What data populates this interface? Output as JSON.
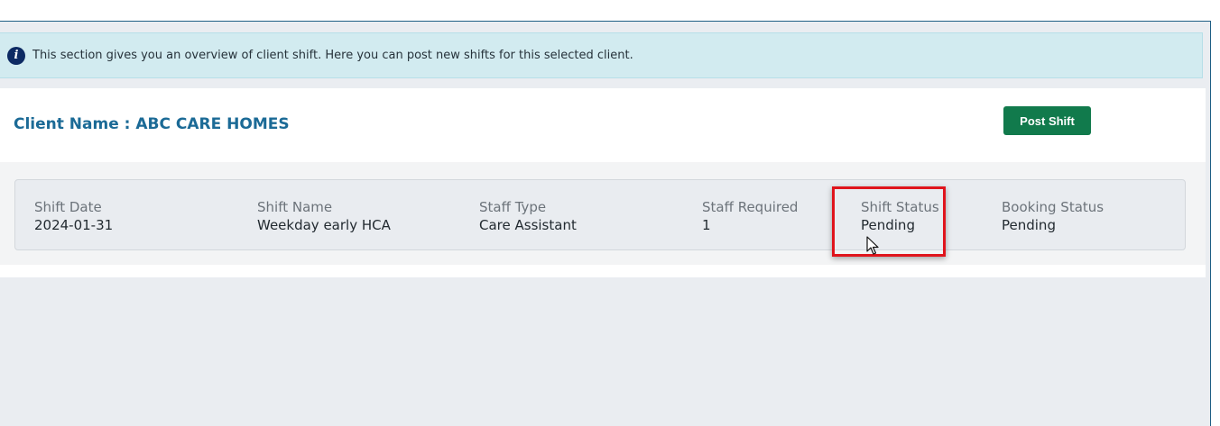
{
  "info": {
    "text": "This section gives you an overview of client shift. Here you can post new shifts for this selected client.",
    "icon": "info-icon"
  },
  "client": {
    "title": "Client Name : ABC CARE HOMES"
  },
  "actions": {
    "post_shift_label": "Post Shift"
  },
  "shift": {
    "columns": [
      {
        "label": "Shift Date",
        "value": "2024-01-31"
      },
      {
        "label": "Shift Name",
        "value": "Weekday early HCA"
      },
      {
        "label": "Staff Type",
        "value": "Care Assistant"
      },
      {
        "label": "Staff Required",
        "value": "1"
      },
      {
        "label": "Shift Status",
        "value": "Pending"
      },
      {
        "label": "Booking Status",
        "value": "Pending"
      }
    ]
  },
  "colors": {
    "accent": "#1b6a96",
    "button": "#117a4c",
    "highlight": "#e0141c",
    "info_bg": "#d2ebf0"
  }
}
